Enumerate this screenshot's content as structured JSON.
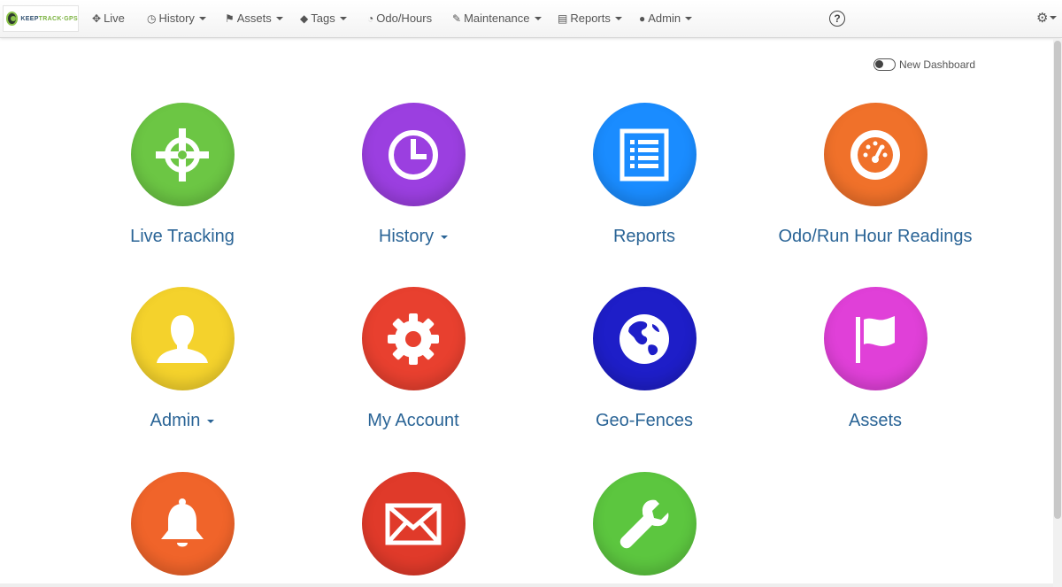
{
  "brand": {
    "part1": "KEEP",
    "part2": "TRACK",
    "part3": "·GPS",
    "color_primary": "#2f4f6f",
    "color_accent": "#7cb342"
  },
  "nav": {
    "items": [
      {
        "label": "Live",
        "icon": "crosshair-icon",
        "dropdown": false
      },
      {
        "label": "History",
        "icon": "clock-icon",
        "dropdown": true
      },
      {
        "label": "Assets",
        "icon": "flag-icon",
        "dropdown": true
      },
      {
        "label": "Tags",
        "icon": "tag-icon",
        "dropdown": true
      },
      {
        "label": "Odo/Hours",
        "icon": "gauge-icon",
        "dropdown": false
      },
      {
        "label": "Maintenance",
        "icon": "wrench-icon",
        "dropdown": true
      },
      {
        "label": "Reports",
        "icon": "list-icon",
        "dropdown": true
      },
      {
        "label": "Admin",
        "icon": "user-icon",
        "dropdown": true
      }
    ],
    "help_symbol": "?",
    "settings_icon": "gear-icon"
  },
  "toggle": {
    "label": "New Dashboard",
    "state": "off"
  },
  "tiles": [
    {
      "label": "Live Tracking",
      "icon": "crosshair-icon",
      "color": "#6cc644",
      "dropdown": false
    },
    {
      "label": "History",
      "icon": "clock-icon",
      "color": "#9b3fe0",
      "dropdown": true
    },
    {
      "label": "Reports",
      "icon": "list-icon",
      "color": "#1a8cff",
      "dropdown": false
    },
    {
      "label": "Odo/Run Hour Readings",
      "icon": "gauge-icon",
      "color": "#f0712a",
      "dropdown": false
    },
    {
      "label": "Admin",
      "icon": "user-icon",
      "color": "#f4d22c",
      "dropdown": true
    },
    {
      "label": "My Account",
      "icon": "gear-icon",
      "color": "#e8402f",
      "dropdown": false
    },
    {
      "label": "Geo-Fences",
      "icon": "globe-icon",
      "color": "#1e1ec8",
      "dropdown": false
    },
    {
      "label": "Assets",
      "icon": "flag-icon",
      "color": "#e040d8",
      "dropdown": false
    },
    {
      "label": "",
      "icon": "bell-icon",
      "color": "#f0642a",
      "dropdown": false
    },
    {
      "label": "",
      "icon": "envelope-icon",
      "color": "#e03a2a",
      "dropdown": false
    },
    {
      "label": "",
      "icon": "wrench-icon",
      "color": "#5cc63f",
      "dropdown": false
    }
  ]
}
